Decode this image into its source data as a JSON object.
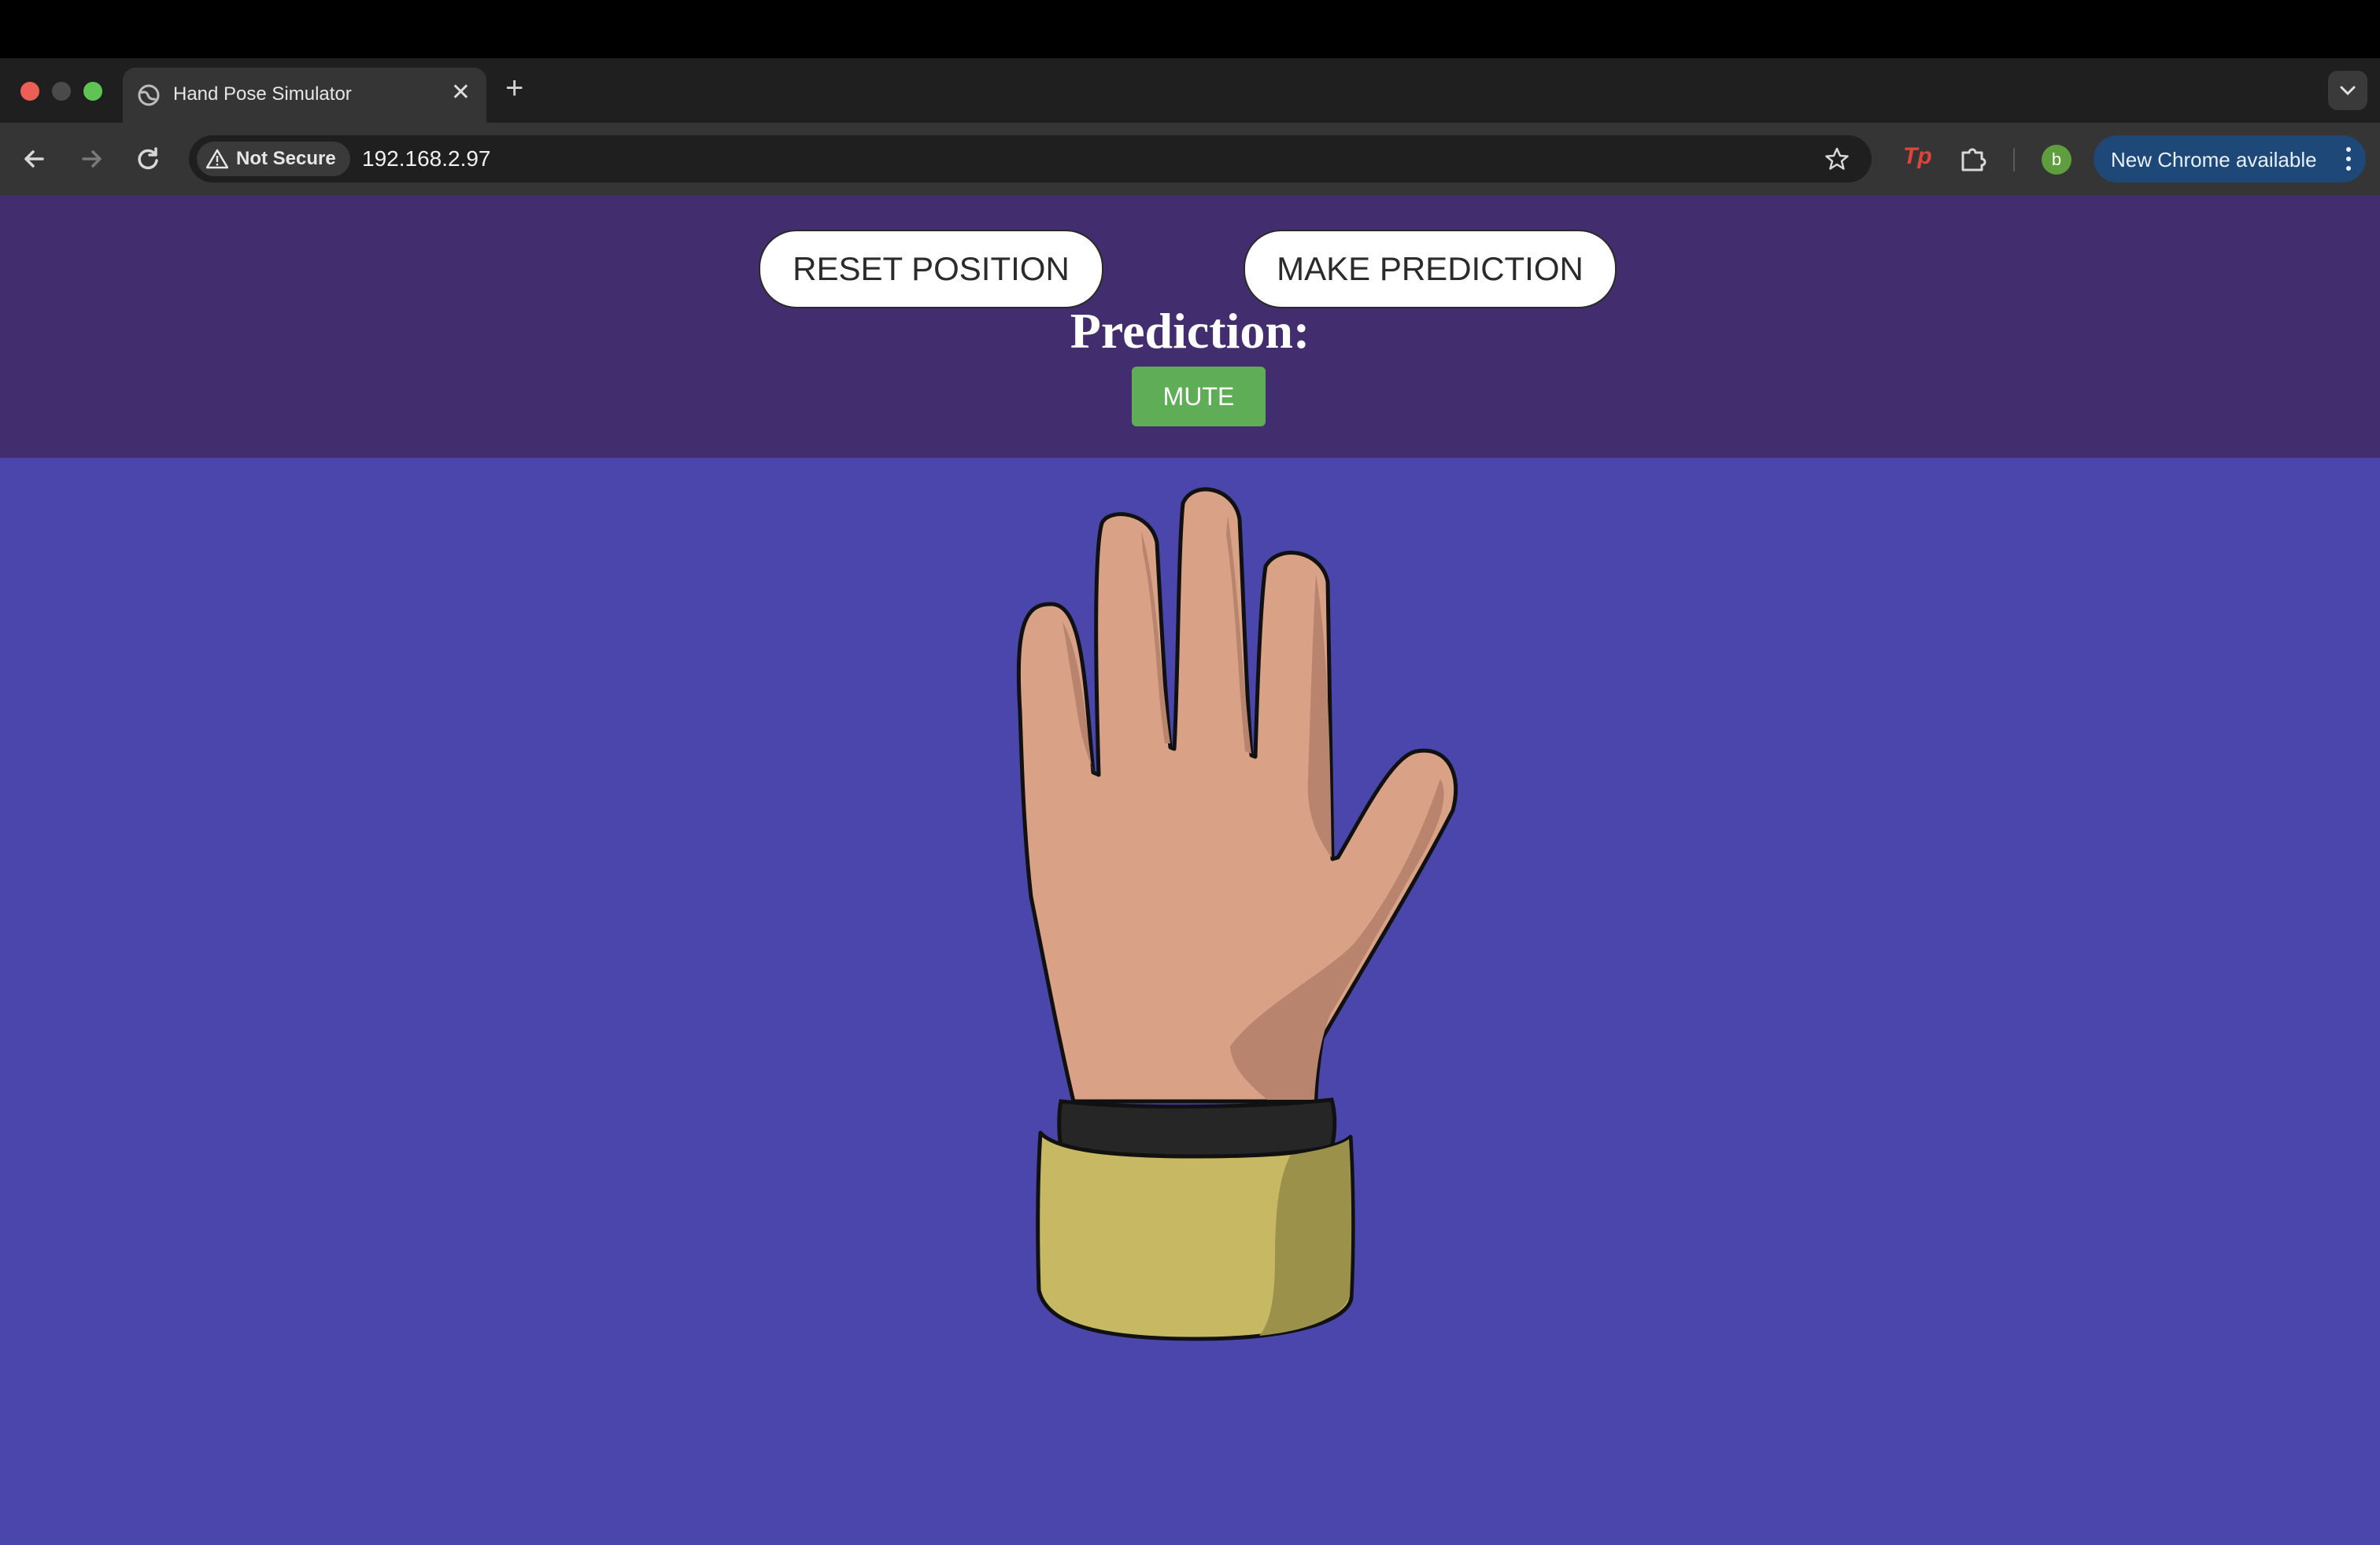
{
  "browser": {
    "tab_title": "Hand Pose Simulator",
    "security_label": "Not Secure",
    "url": "192.168.2.97",
    "extension_label": "Tp",
    "profile_initial": "b",
    "update_label": "New Chrome available"
  },
  "page": {
    "reset_button": "RESET POSITION",
    "predict_button": "MAKE PREDICTION",
    "prediction_heading": "Prediction:",
    "mute_button": "MUTE"
  },
  "colors": {
    "controls_background": "#422d6e",
    "stage_background": "#4a46ac",
    "mute_green": "#5fad56",
    "skin": "#d9a186",
    "skin_shadow": "#b8846d",
    "cuff": "#c7b963",
    "cuff_shadow": "#9c914a",
    "wristband": "#262626"
  },
  "icons": [
    "globe-icon",
    "close-icon",
    "plus-icon",
    "chevron-down-icon",
    "back-icon",
    "forward-icon",
    "reload-icon",
    "warning-icon",
    "star-icon",
    "puzzle-icon",
    "kebab-icon"
  ]
}
